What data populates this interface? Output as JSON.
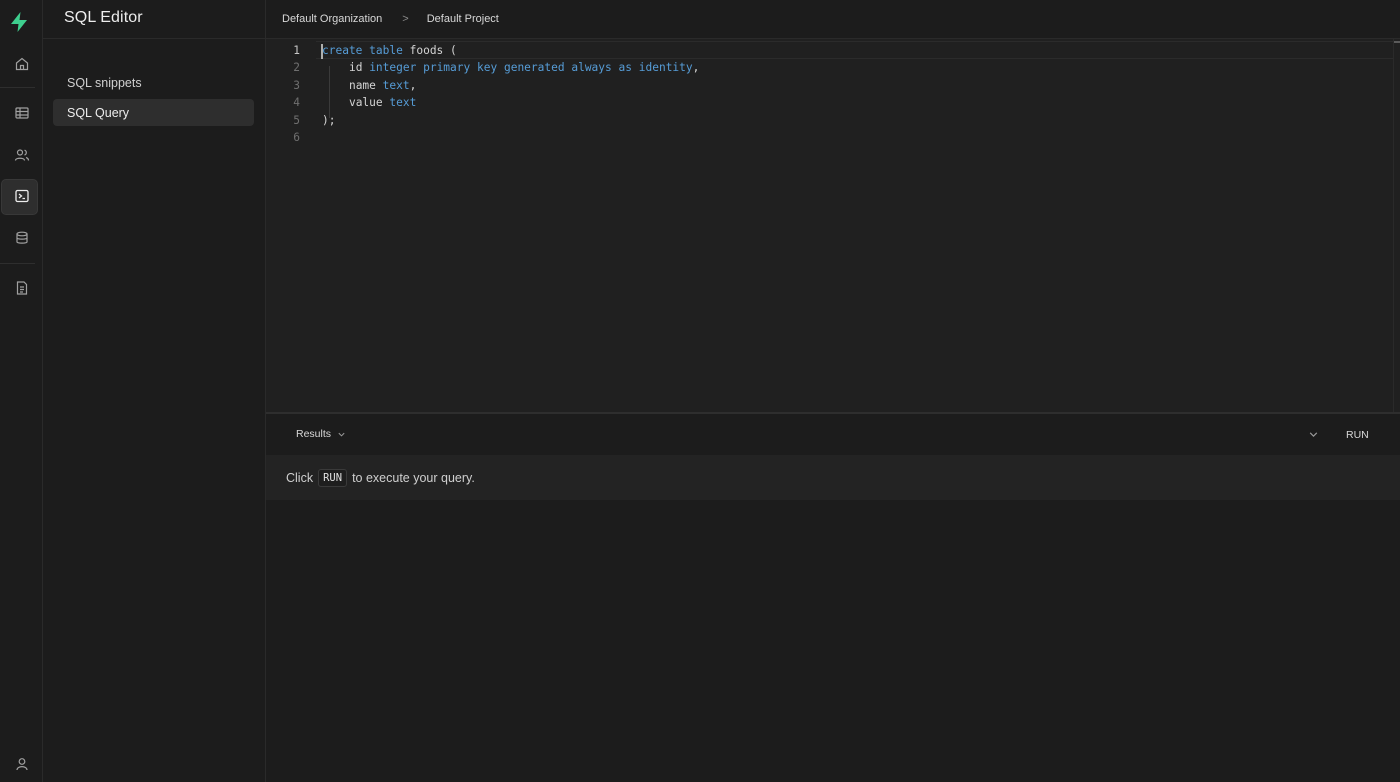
{
  "sidebar": {
    "title": "SQL Editor",
    "items": [
      {
        "label": "SQL snippets"
      },
      {
        "label": "SQL Query",
        "active": true
      }
    ]
  },
  "rail": {
    "icons": [
      "supabase-logo-icon",
      "home-icon",
      "table-icon",
      "users-icon",
      "terminal-icon",
      "database-icon",
      "document-icon",
      "account-icon"
    ],
    "active": "terminal-icon",
    "accent_color": "#3ecf8e"
  },
  "header": {
    "breadcrumb": [
      "Default Organization",
      "Default Project"
    ],
    "separator": ">"
  },
  "editor": {
    "line_numbers": [
      "1",
      "2",
      "3",
      "4",
      "5",
      "6"
    ],
    "current_line": "1",
    "lines": [
      "create table foods (",
      "    id integer primary key generated always as identity,",
      "    name text,",
      "    value text",
      ");",
      ""
    ]
  },
  "results": {
    "tab_label": "Results",
    "run_label": "RUN",
    "message_before": "Click",
    "message_code": "RUN",
    "message_after": "to execute your query."
  }
}
